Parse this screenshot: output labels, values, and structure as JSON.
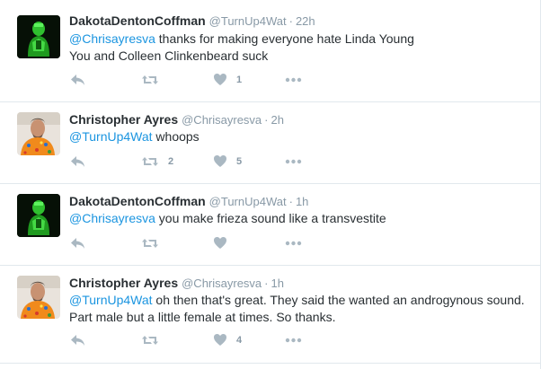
{
  "tweets": [
    {
      "name": "DakotaDentonCoffman",
      "handle": "@TurnUp4Wat",
      "separator": "·",
      "time": "22h",
      "mention": "@Chrisayresva",
      "text_after_mention": " thanks for making everyone hate Linda Young",
      "line2": "You and Colleen Clinkenbeard suck",
      "retweet_count": "",
      "like_count": "1",
      "avatar": "green-figure-avatar"
    },
    {
      "name": "Christopher Ayres",
      "handle": "@Chrisayresva",
      "separator": "·",
      "time": "2h",
      "mention": "@TurnUp4Wat",
      "text_after_mention": " whoops",
      "line2": "",
      "retweet_count": "2",
      "like_count": "5",
      "avatar": "man-in-orange-shirt-avatar"
    },
    {
      "name": "DakotaDentonCoffman",
      "handle": "@TurnUp4Wat",
      "separator": "·",
      "time": "1h",
      "mention": "@Chrisayresva",
      "text_after_mention": " you make frieza sound like a transvestite",
      "line2": "",
      "retweet_count": "",
      "like_count": "",
      "avatar": "green-figure-avatar"
    },
    {
      "name": "Christopher Ayres",
      "handle": "@Chrisayresva",
      "separator": "·",
      "time": "1h",
      "mention": "@TurnUp4Wat",
      "text_after_mention": " oh then that's great. They said the wanted an androgynous sound. Part male but a little female at times. So thanks.",
      "line2": "",
      "retweet_count": "",
      "like_count": "4",
      "avatar": "man-in-orange-shirt-avatar"
    }
  ],
  "colors": {
    "link": "#1b95e0",
    "text": "#292f33",
    "muted": "#8899a6",
    "icon": "#aab8c2",
    "border": "#e1e8ed",
    "background": "#f5f8fa"
  },
  "icons": {
    "reply": "reply-icon",
    "retweet": "retweet-icon",
    "like": "heart-icon",
    "more": "more-dots-icon"
  }
}
